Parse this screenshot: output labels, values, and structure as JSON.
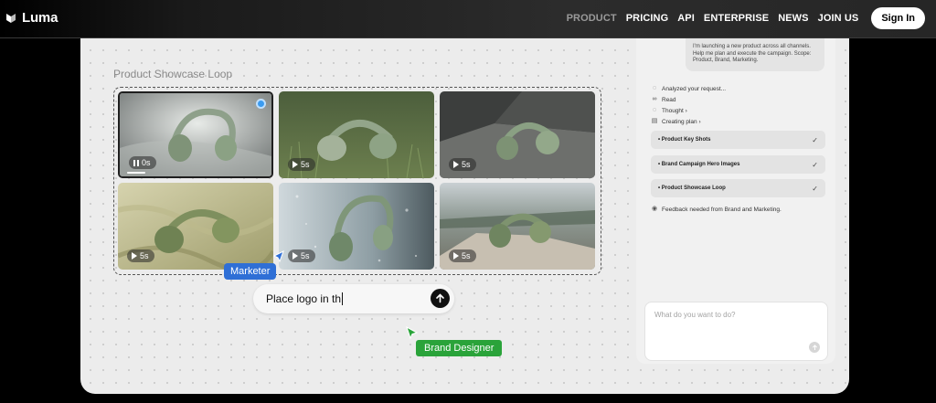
{
  "nav": {
    "brand": "Luma",
    "items": [
      "PRODUCT",
      "PRICING",
      "API",
      "ENTERPRISE",
      "NEWS",
      "JOIN US"
    ],
    "active": "PRODUCT",
    "signin_label": "Sign In"
  },
  "board": {
    "title": "Product Showcase Loop",
    "tiles": [
      {
        "badge": "0s",
        "state": "paused",
        "selected": true,
        "scene": "studio-white"
      },
      {
        "badge": "5s",
        "state": "play",
        "selected": false,
        "scene": "grass"
      },
      {
        "badge": "5s",
        "state": "play",
        "selected": false,
        "scene": "concrete"
      },
      {
        "badge": "5s",
        "state": "play",
        "selected": false,
        "scene": "olive-fabric"
      },
      {
        "badge": "5s",
        "state": "play",
        "selected": false,
        "scene": "rain-glass"
      },
      {
        "badge": "5s",
        "state": "play",
        "selected": false,
        "scene": "driftwood"
      }
    ]
  },
  "cursors": {
    "marketer": "Marketer",
    "designer": "Brand Designer"
  },
  "prompt": {
    "value": "Place logo in th"
  },
  "chat": {
    "message": "I'm launching a new product across all channels. Help me plan and execute the campaign. Scope: Product, Brand, Marketing.",
    "steps": [
      {
        "icon": "chat-icon",
        "label": "Analyzed your request..."
      },
      {
        "icon": "link-icon",
        "label": "Read"
      },
      {
        "icon": "chat-icon",
        "label": "Thought ›"
      },
      {
        "icon": "doc-icon",
        "label": "Creating plan ›"
      }
    ],
    "tasks": [
      {
        "label": "• Product Key Shots",
        "check": "✓"
      },
      {
        "label": "• Brand Campaign Hero Images",
        "check": "✓"
      },
      {
        "label": "• Product Showcase Loop",
        "check": "✓"
      }
    ],
    "feedback": "Feedback needed from Brand and Marketing.",
    "input_placeholder": "What do you want to do?"
  },
  "colors": {
    "marketer": "#2f6fd6",
    "designer": "#2aa33a",
    "headphone": "#7d9274"
  }
}
